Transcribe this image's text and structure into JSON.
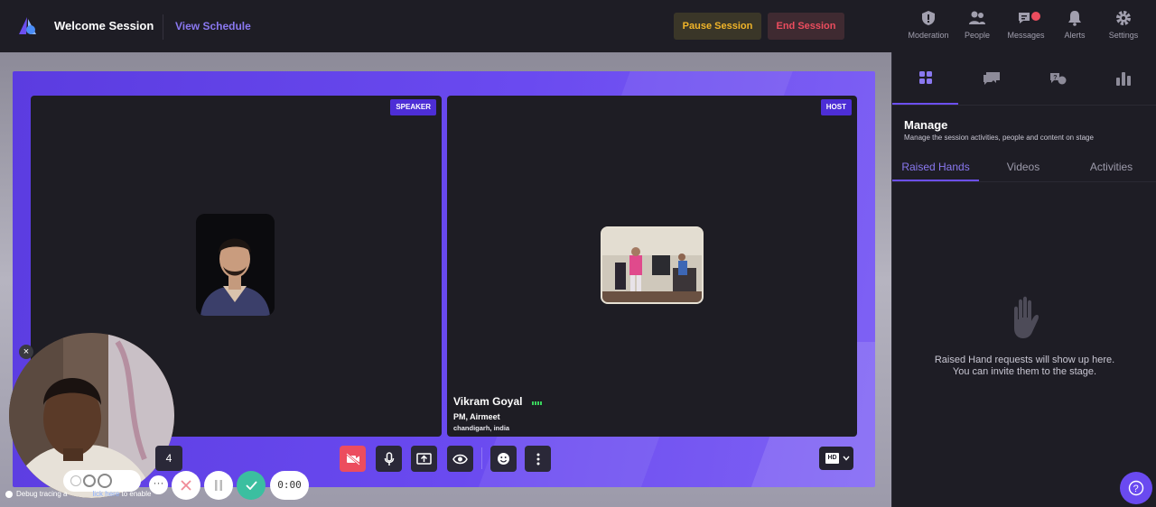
{
  "header": {
    "title": "Welcome Session",
    "view_schedule": "View Schedule",
    "pause_session": "Pause Session",
    "end_session": "End Session",
    "nav": [
      {
        "label": "Moderation",
        "icon": "shield-icon"
      },
      {
        "label": "People",
        "icon": "people-icon"
      },
      {
        "label": "Messages",
        "icon": "messages-icon"
      },
      {
        "label": "Alerts",
        "icon": "bell-icon"
      },
      {
        "label": "Settings",
        "icon": "gear-icon"
      }
    ]
  },
  "stage": {
    "speaker_badge": "SPEAKER",
    "host_badge": "HOST",
    "host_name": "Vikram Goyal",
    "host_role": "PM, Airmeet",
    "host_location": "chandigarh, india",
    "hd_label": "HD"
  },
  "panel": {
    "title": "Manage",
    "subtitle": "Manage the session activities, people and content on stage",
    "tabs": [
      "Raised Hands",
      "Videos",
      "Activities"
    ],
    "empty_message": "Raised Hand requests will show up here. You can invite them to the stage."
  },
  "recorder": {
    "count": "4",
    "timer": "0:00",
    "more": "···",
    "debug_prefix": "Debug tracing a",
    "debug_link": "lick here",
    "debug_suffix": " to enable"
  },
  "colors": {
    "accent": "#6c4ff0",
    "pause": "#f0b429",
    "end": "#ec4d5e"
  }
}
